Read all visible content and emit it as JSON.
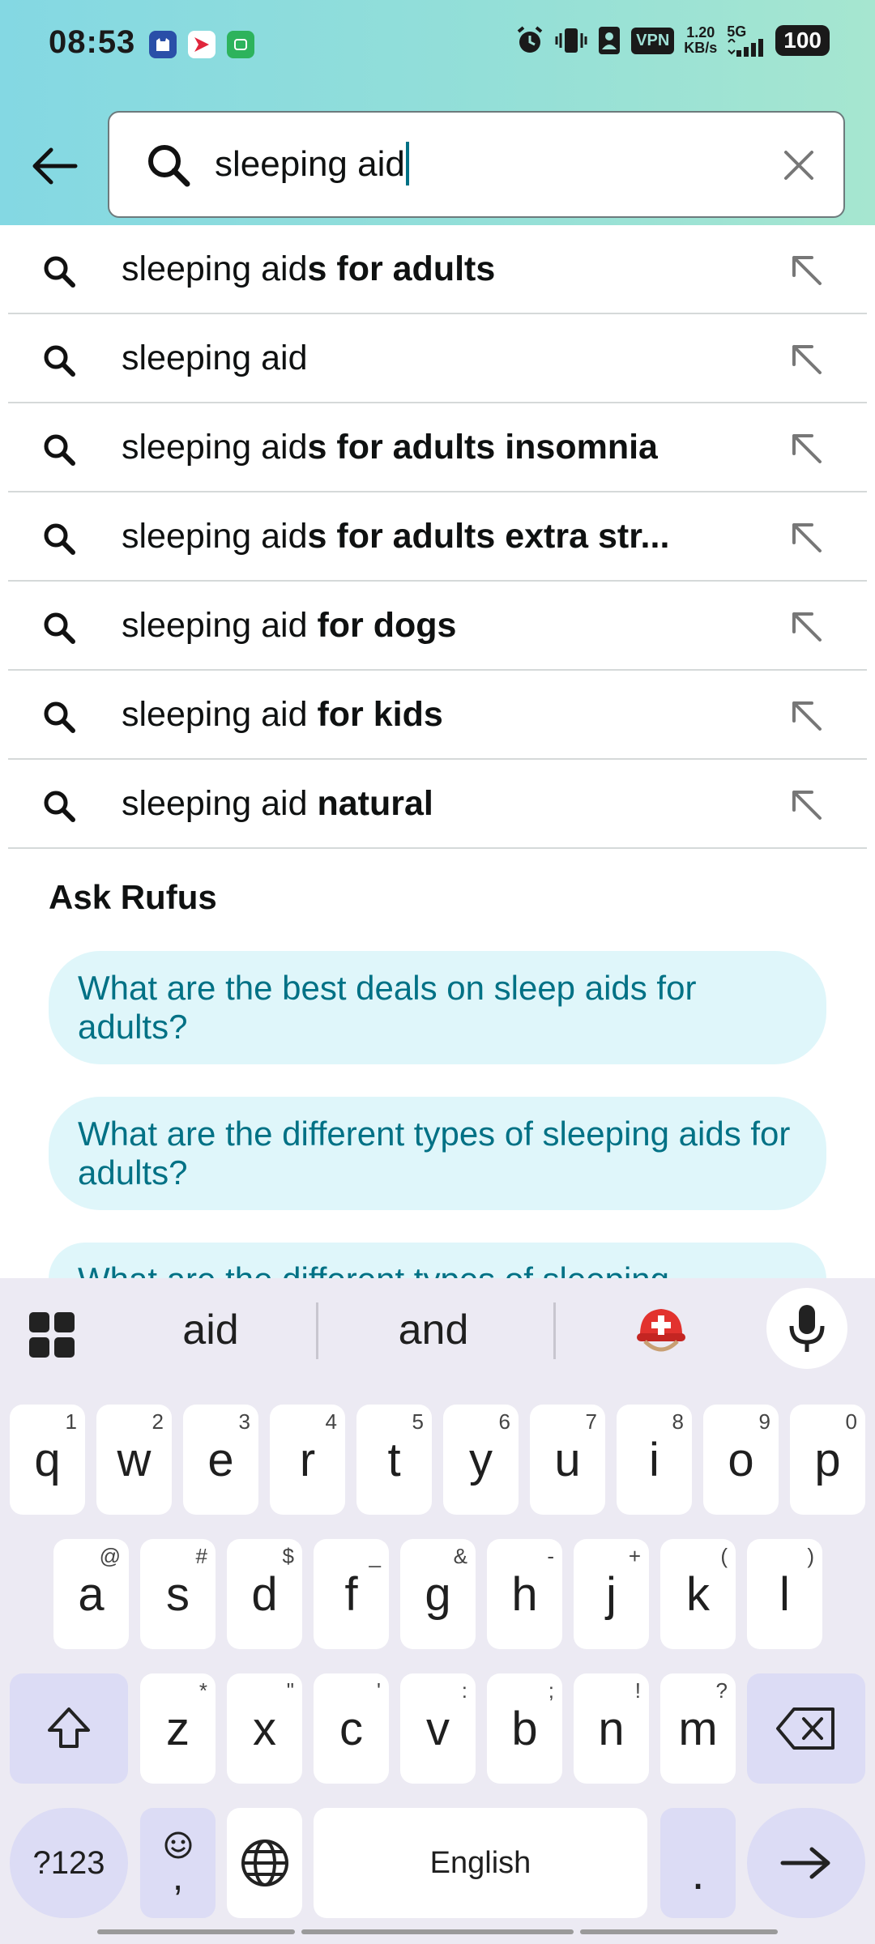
{
  "status_bar": {
    "time": "08:53",
    "vpn": "VPN",
    "net_speed_value": "1.20",
    "net_speed_unit": "KB/s",
    "network": "5G",
    "battery": "100"
  },
  "search": {
    "query": "sleeping aid"
  },
  "suggestions": [
    {
      "prefix": "sleeping aid",
      "bold": "s for adults"
    },
    {
      "prefix": "sleeping aid",
      "bold": ""
    },
    {
      "prefix": "sleeping aid",
      "bold": "s for adults insomnia"
    },
    {
      "prefix": "sleeping aid",
      "bold": "s for adults extra str..."
    },
    {
      "prefix": "sleeping aid ",
      "bold": "for dogs"
    },
    {
      "prefix": "sleeping aid ",
      "bold": "for kids"
    },
    {
      "prefix": "sleeping aid ",
      "bold": "natural"
    }
  ],
  "rufus": {
    "title": "Ask Rufus",
    "questions": [
      "What are the best deals on sleep aids for adults?",
      "What are the different types of sleeping aids for adults?",
      "What are the different types of sleeping"
    ]
  },
  "keyboard": {
    "suggestions": [
      "aid",
      "and"
    ],
    "row1": [
      {
        "key": "q",
        "hint": "1"
      },
      {
        "key": "w",
        "hint": "2"
      },
      {
        "key": "e",
        "hint": "3"
      },
      {
        "key": "r",
        "hint": "4"
      },
      {
        "key": "t",
        "hint": "5"
      },
      {
        "key": "y",
        "hint": "6"
      },
      {
        "key": "u",
        "hint": "7"
      },
      {
        "key": "i",
        "hint": "8"
      },
      {
        "key": "o",
        "hint": "9"
      },
      {
        "key": "p",
        "hint": "0"
      }
    ],
    "row2": [
      {
        "key": "a",
        "hint": "@"
      },
      {
        "key": "s",
        "hint": "#"
      },
      {
        "key": "d",
        "hint": "$"
      },
      {
        "key": "f",
        "hint": "_"
      },
      {
        "key": "g",
        "hint": "&"
      },
      {
        "key": "h",
        "hint": "-"
      },
      {
        "key": "j",
        "hint": "+"
      },
      {
        "key": "k",
        "hint": "("
      },
      {
        "key": "l",
        "hint": ")"
      }
    ],
    "row3": [
      {
        "key": "z",
        "hint": "*"
      },
      {
        "key": "x",
        "hint": "\""
      },
      {
        "key": "c",
        "hint": "'"
      },
      {
        "key": "v",
        "hint": ":"
      },
      {
        "key": "b",
        "hint": ";"
      },
      {
        "key": "n",
        "hint": "!"
      },
      {
        "key": "m",
        "hint": "?"
      }
    ],
    "symbols_label": "?123",
    "comma": ",",
    "space_label": "English",
    "period": "."
  },
  "colors": {
    "header_gradient_start": "#84d8e3",
    "header_gradient_end": "#a6e6d0",
    "link_teal": "#007185",
    "chip_bg": "#dff6fa",
    "keyboard_bg": "#eceaf3",
    "mod_key_bg": "#dcdcf5"
  }
}
